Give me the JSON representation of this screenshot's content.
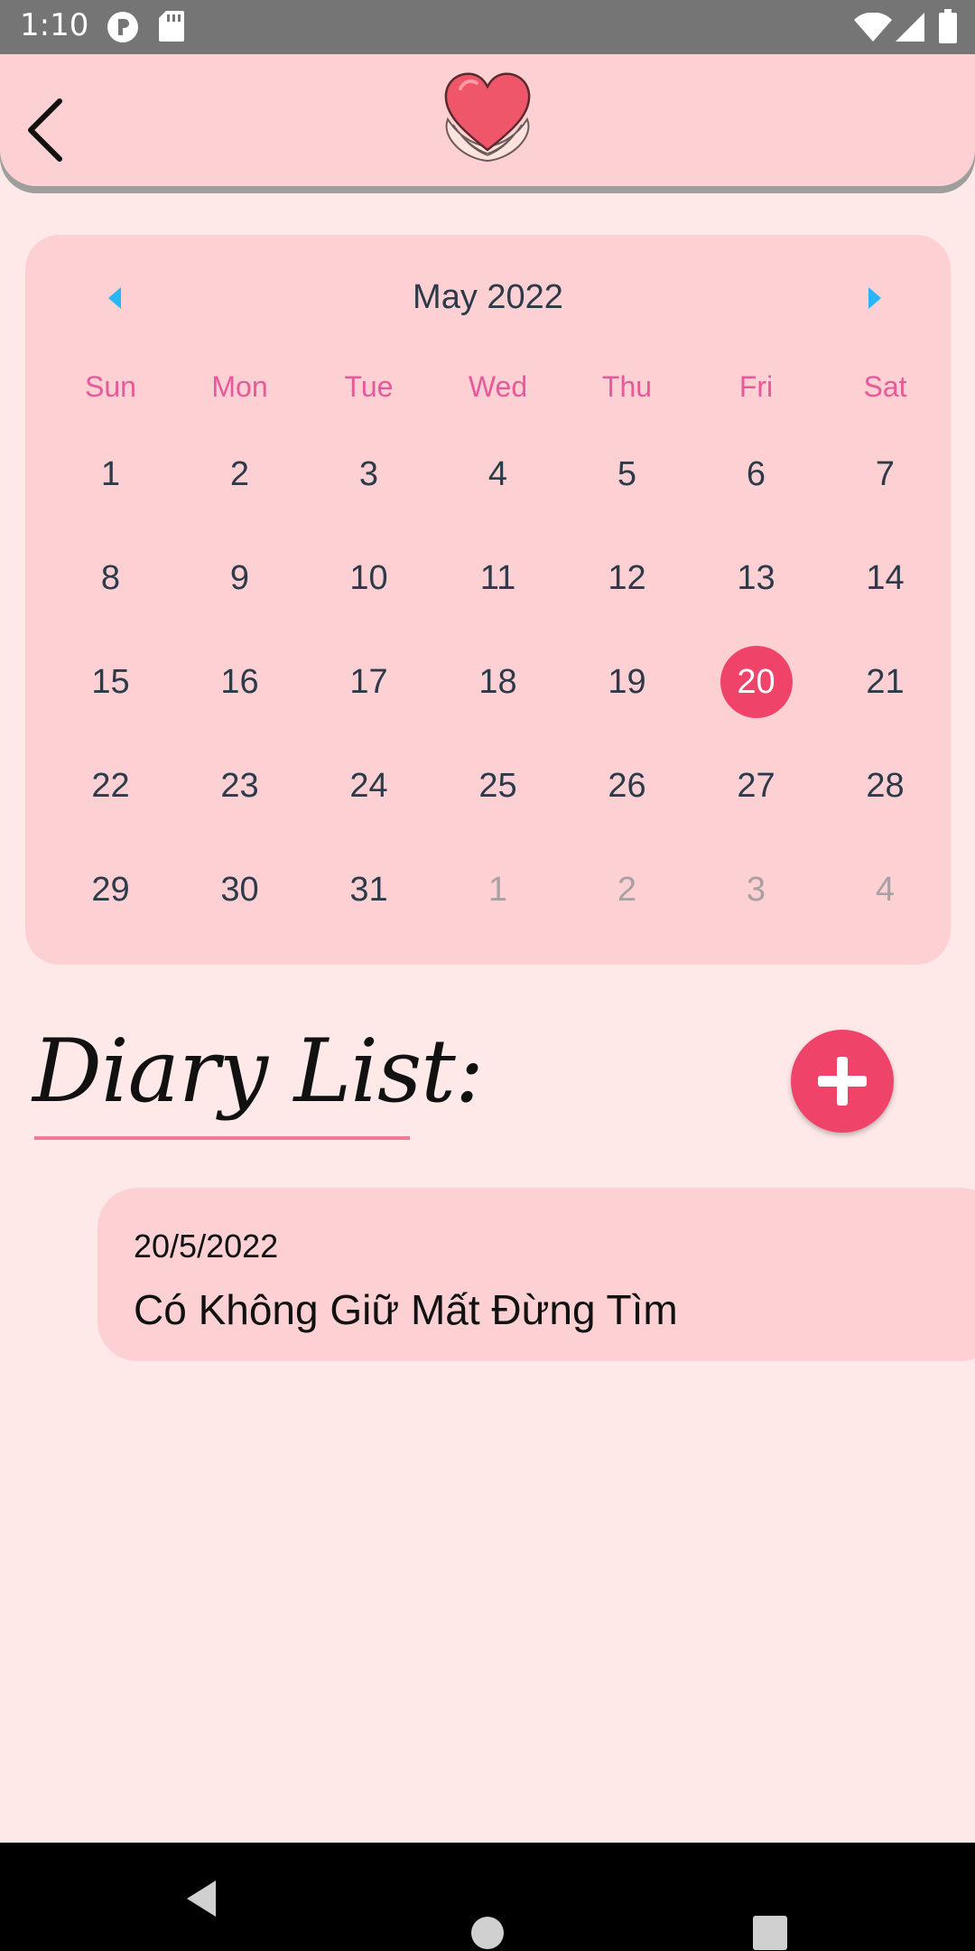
{
  "status_bar": {
    "time": "1:10"
  },
  "calendar": {
    "title": "May 2022",
    "weekdays": [
      "Sun",
      "Mon",
      "Tue",
      "Wed",
      "Thu",
      "Fri",
      "Sat"
    ],
    "weeks": [
      [
        "1",
        "2",
        "3",
        "4",
        "5",
        "6",
        "7"
      ],
      [
        "8",
        "9",
        "10",
        "11",
        "12",
        "13",
        "14"
      ],
      [
        "15",
        "16",
        "17",
        "18",
        "19",
        "20",
        "21"
      ],
      [
        "22",
        "23",
        "24",
        "25",
        "26",
        "27",
        "28"
      ],
      [
        "29",
        "30",
        "31",
        "1",
        "2",
        "3",
        "4"
      ]
    ],
    "selected_day": "20",
    "accent_color": "#f0436a",
    "weekday_color": "#e8589a",
    "nav_arrow_color": "#29b6f6"
  },
  "diary": {
    "title": "Diary List:",
    "entries": [
      {
        "date": "20/5/2022",
        "title": "Có Không Giữ Mất Đừng Tìm"
      }
    ]
  }
}
